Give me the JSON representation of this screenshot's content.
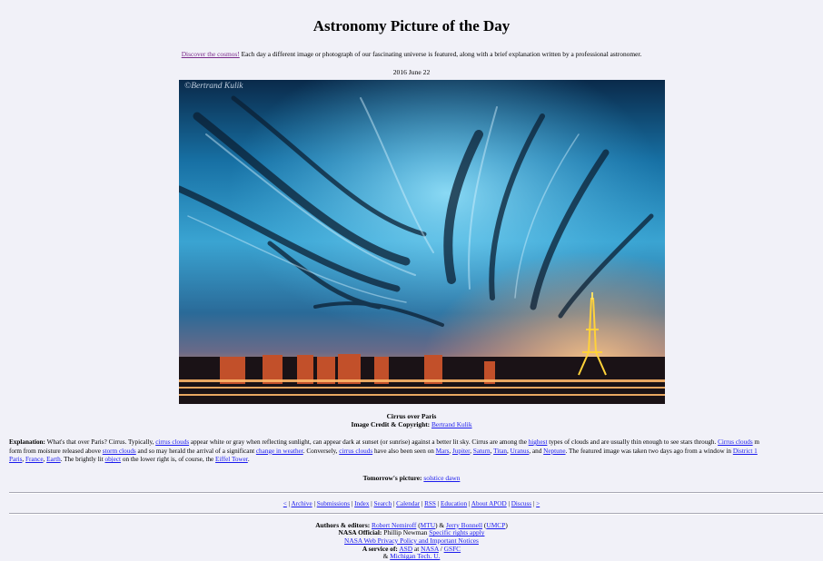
{
  "header": {
    "title": "Astronomy Picture of the Day",
    "discover_link": "Discover the cosmos!",
    "tagline_rest": " Each day a different image or photograph of our fascinating universe is featured, along with a brief explanation written by a professional astronomer.",
    "date": "2016 June 22"
  },
  "image": {
    "watermark": "©Bertrand Kulik"
  },
  "caption": {
    "title": "Cirrus over Paris",
    "credit_label": "Image Credit & Copyright:",
    "credit_link": "Bertrand Kulik"
  },
  "explanation": {
    "label": "Explanation:",
    "t1": " What's that over Paris? Cirrus. Typically, ",
    "l1": "cirrus clouds",
    "t2": " appear white or gray when reflecting sunlight, can appear dark at sunset (or sunrise) against a better lit sky. Cirrus are among the ",
    "l2": "highest",
    "t3": " types of clouds and are usually thin enough to see stars through. ",
    "l3": "Cirrus clouds",
    "t4": " m",
    "t5": "form from moisture released above ",
    "l4": "storm clouds",
    "t6": " and so may herald the arrival of a significant ",
    "l5": "change in weather",
    "t7": ". Conversely, ",
    "l6": "cirrus clouds",
    "t8": " have also been seen on ",
    "l_mars": "Mars",
    "l_jupiter": "Jupiter",
    "l_saturn": "Saturn",
    "l_titan": "Titan",
    "l_uranus": "Uranus",
    "l_neptune": "Neptune",
    "t9": ". The featured image was taken two days ago from a window in ",
    "l_district": "District 1",
    "l_paris": "Paris",
    "l_france": "France",
    "l_earth": "Earth",
    "t10": ". The brightly lit ",
    "l_object": "object",
    "t11": " on the lower right is, of course, the ",
    "l_eiffel": "Eiffel Tower",
    "t12": "."
  },
  "tomorrow": {
    "label": "Tomorrow's picture:",
    "link": "solstice dawn"
  },
  "nav": {
    "prev": "<",
    "archive": "Archive",
    "submissions": "Submissions",
    "index": "Index",
    "search": "Search",
    "calendar": "Calendar",
    "rss": "RSS",
    "education": "Education",
    "about": "About APOD",
    "discuss": "Discuss",
    "next": ">"
  },
  "footer": {
    "authors_label": "Authors & editors:",
    "nemiroff": "Robert Nemiroff",
    "mtu": "MTU",
    "bonnell": "Jerry Bonnell",
    "umcp": "UMCP",
    "nasa_official_label": "NASA Official:",
    "nasa_official_name": " Phillip Newman ",
    "rights_link": "Specific rights apply",
    "privacy_link": "NASA Web Privacy Policy and Important Notices",
    "service_label": "A service of:",
    "asd": "ASD",
    "nasa": "NASA",
    "gsfc": "GSFC",
    "michigan": "Michigan Tech. U."
  },
  "colors": {
    "background": "#f1f1f8",
    "link": "#1a1aee",
    "visited_link": "#7a2a8a"
  }
}
